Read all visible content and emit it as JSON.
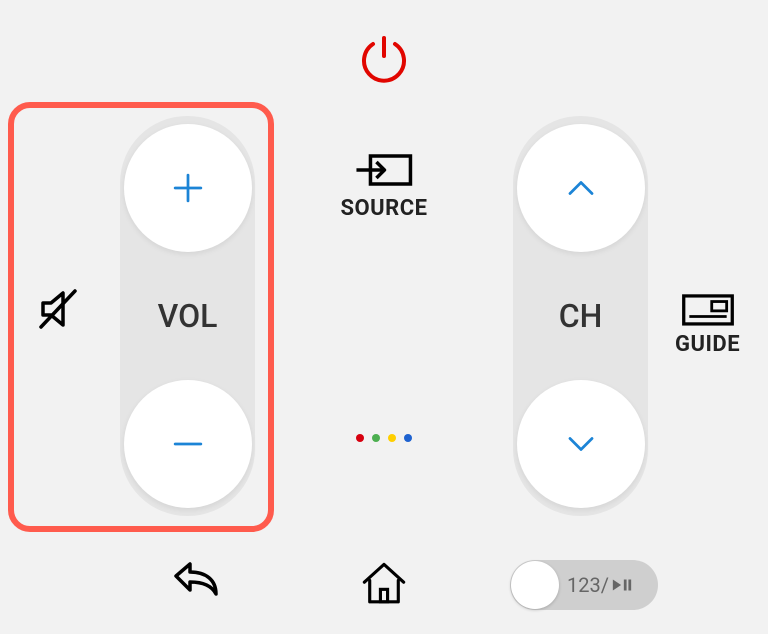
{
  "power": {
    "color": "#e10600"
  },
  "mute": {
    "icon": "mute-icon"
  },
  "volume": {
    "label": "VOL",
    "up_icon": "plus-icon",
    "down_icon": "minus-icon"
  },
  "channel": {
    "label": "CH",
    "up_icon": "chevron-up-icon",
    "down_icon": "chevron-down-icon"
  },
  "source": {
    "label": "SOURCE"
  },
  "guide": {
    "label": "GUIDE"
  },
  "color_dots": [
    "#d7000f",
    "#4caf50",
    "#ffcf00",
    "#1e62d0"
  ],
  "mode_toggle": {
    "label": "123/"
  },
  "accent": "#1c84d6",
  "highlight_color": "#ff5b4d"
}
